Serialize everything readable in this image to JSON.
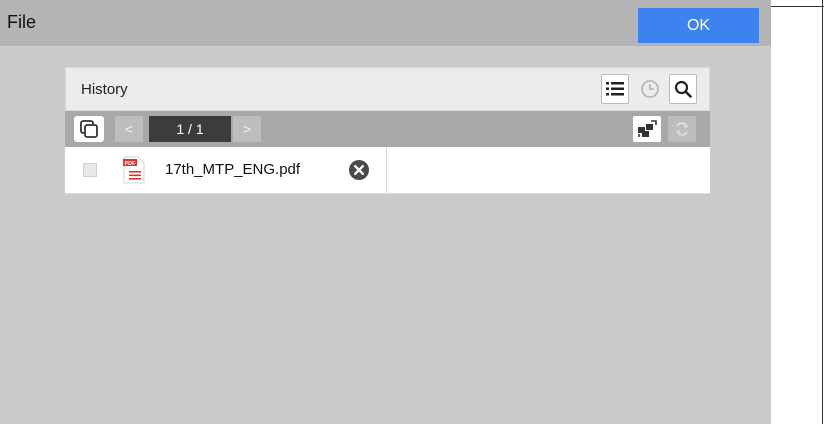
{
  "dialog": {
    "title": "File",
    "ok_label": "OK",
    "accent_color": "#3d82ee"
  },
  "panel": {
    "title": "History",
    "header_icons": [
      "list-view-icon",
      "clock-icon",
      "search-icon"
    ]
  },
  "toolbar": {
    "prev_label": "<",
    "page_indicator": "1 / 1",
    "next_label": ">",
    "icons": [
      "copy-icon",
      "move-icon",
      "refresh-icon"
    ]
  },
  "files": [
    {
      "name": "17th_MTP_ENG.pdf",
      "type_badge": "PDF",
      "checked": false
    }
  ]
}
